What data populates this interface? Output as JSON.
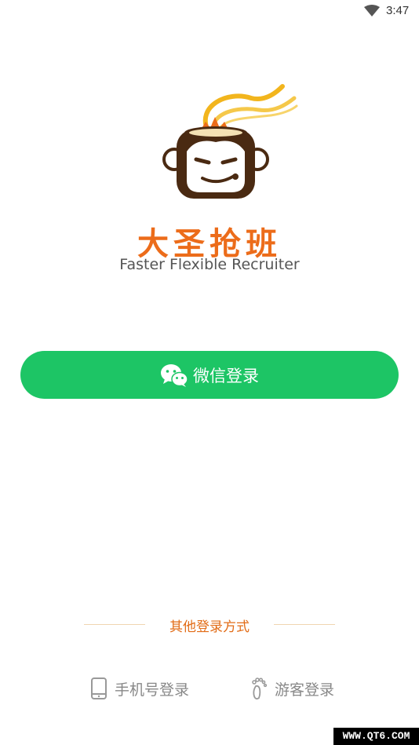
{
  "status_bar": {
    "time": "3:47",
    "wifi_icon": "wifi-icon"
  },
  "brand": {
    "title": "大圣抢班",
    "subtitle": "Faster Flexible Recruiter",
    "logo": "monkey-logo"
  },
  "wechat_login": {
    "label": "微信登录",
    "icon": "wechat-icon",
    "color": "#1dc565"
  },
  "other_methods": {
    "label": "其他登录方式",
    "phone": {
      "label": "手机号登录",
      "icon": "phone-icon"
    },
    "guest": {
      "label": "游客登录",
      "icon": "footprint-icon"
    }
  },
  "watermark": {
    "text": "WWW.QT6.COM"
  },
  "colors": {
    "accent": "#ec6c1a",
    "wechat": "#1dc565",
    "muted": "#888888"
  }
}
